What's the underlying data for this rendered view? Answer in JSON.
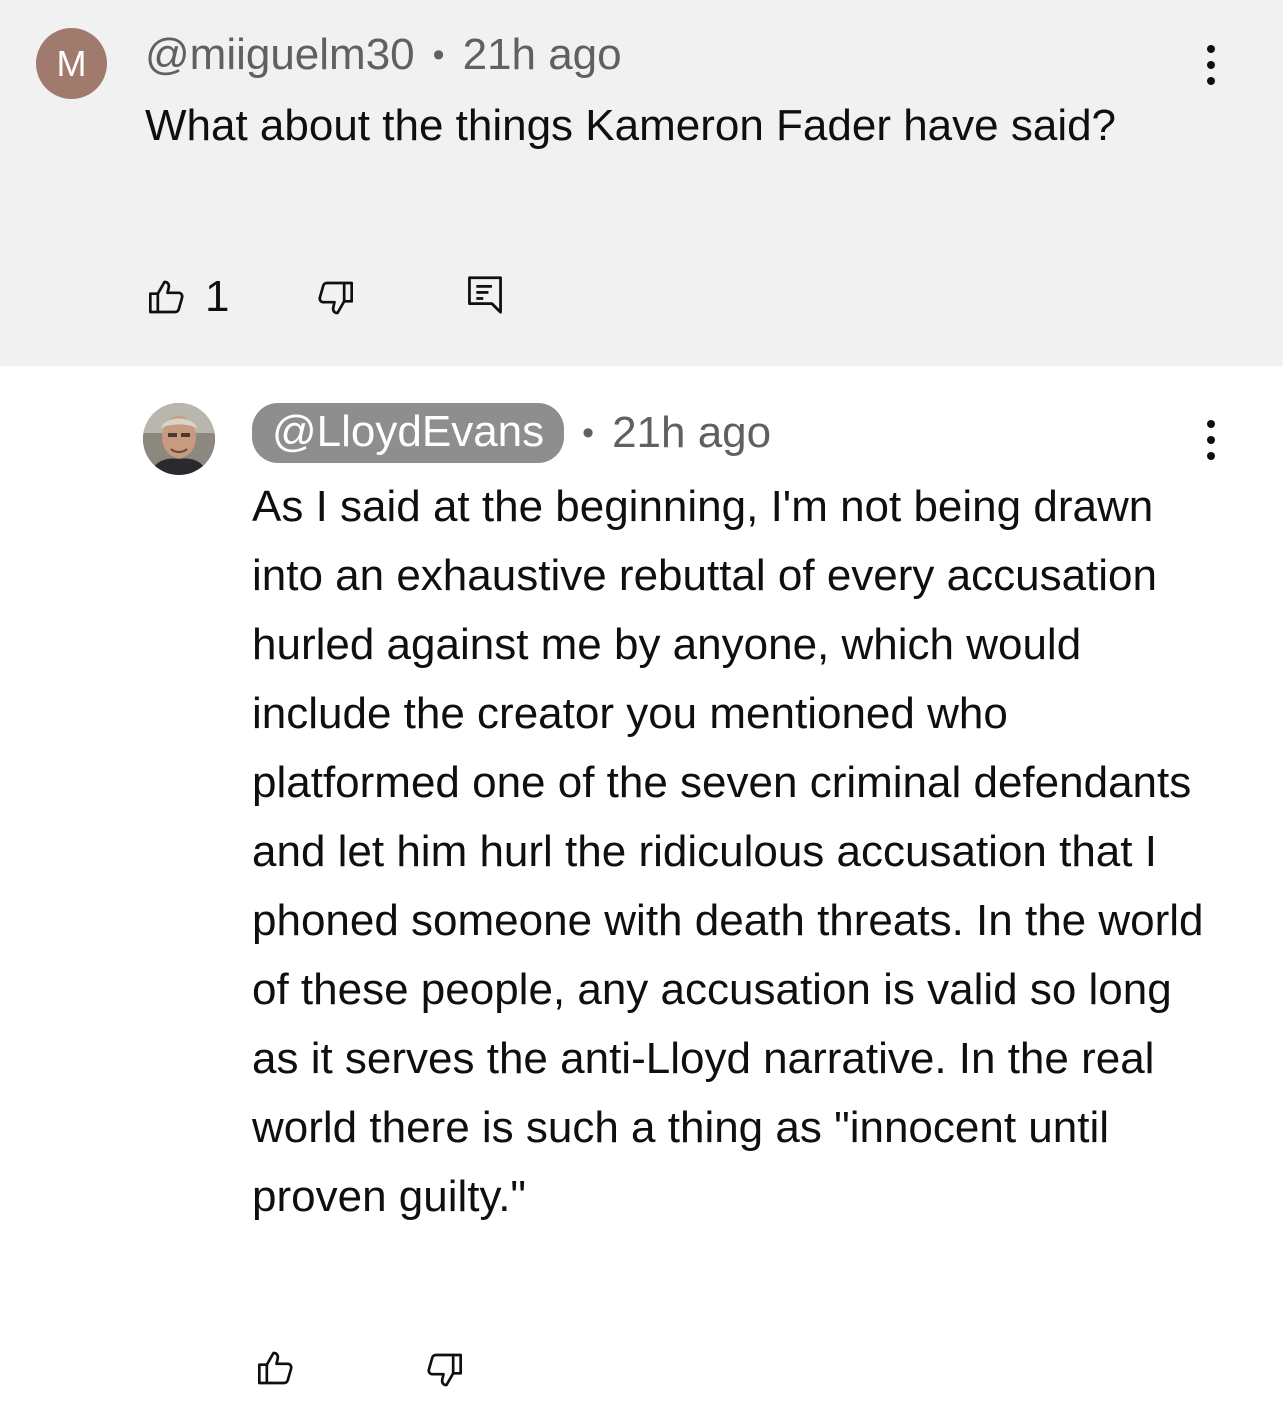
{
  "comment": {
    "avatar_letter": "M",
    "author": "@miiguelm30",
    "time": "21h ago",
    "text": "What about the things Kameron Fader have said?",
    "like_count": "1",
    "avatar_color": "#a07a6c",
    "icons": [
      "like-icon",
      "dislike-icon",
      "reply-icon",
      "more-options-icon"
    ]
  },
  "reply": {
    "author": "@LloydEvans",
    "time": "21h ago",
    "text": "As I said at the beginning, I'm not being drawn into an exhaustive rebuttal of every accusation hurled against me by anyone, which would include the creator you mentioned who platformed one of the seven criminal defendants and let him hurl the ridiculous accusation that I phoned someone with death threats. In the world of these people, any accusation is valid so long as it serves the anti-Lloyd narrative. In the real world there is such a thing as \"innocent until proven guilty.\"",
    "author_chip_color": "#8e8e8e",
    "icons": [
      "like-icon",
      "dislike-icon",
      "more-options-icon"
    ]
  },
  "separator": "•"
}
